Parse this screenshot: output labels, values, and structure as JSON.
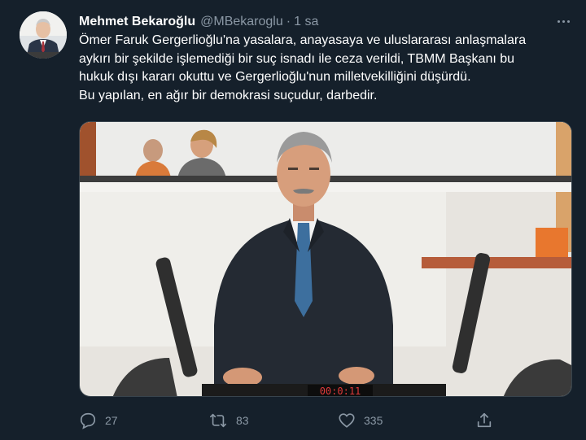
{
  "tweet": {
    "author": {
      "name": "Mehmet Bekaroğlu",
      "handle": "@MBekaroglu",
      "separator": "·",
      "time": "1 sa"
    },
    "text_lines": [
      "Ömer Faruk Gergerlioğlu'na yasalara, anayasaya ve uluslararası anlaşmalara",
      "aykırı bir şekilde işlemediği bir suç isnadı ile ceza verildi, TBMM Başkanı bu",
      "hukuk dışı kararı okuttu ve Gergerlioğlu'nun milletvekilliğini düşürdü.",
      "Bu yapılan, en ağır bir demokrasi suçudur, darbedir."
    ],
    "media": {
      "clock_display": "00:0:11"
    },
    "actions": {
      "reply_icon": "reply-icon",
      "reply_count": "27",
      "retweet_icon": "retweet-icon",
      "retweet_count": "83",
      "like_icon": "heart-icon",
      "like_count": "335",
      "share_icon": "share-icon"
    }
  },
  "colors": {
    "background": "#15202b",
    "text_primary": "#ffffff",
    "text_secondary": "#8b98a5",
    "border": "#38444d"
  }
}
